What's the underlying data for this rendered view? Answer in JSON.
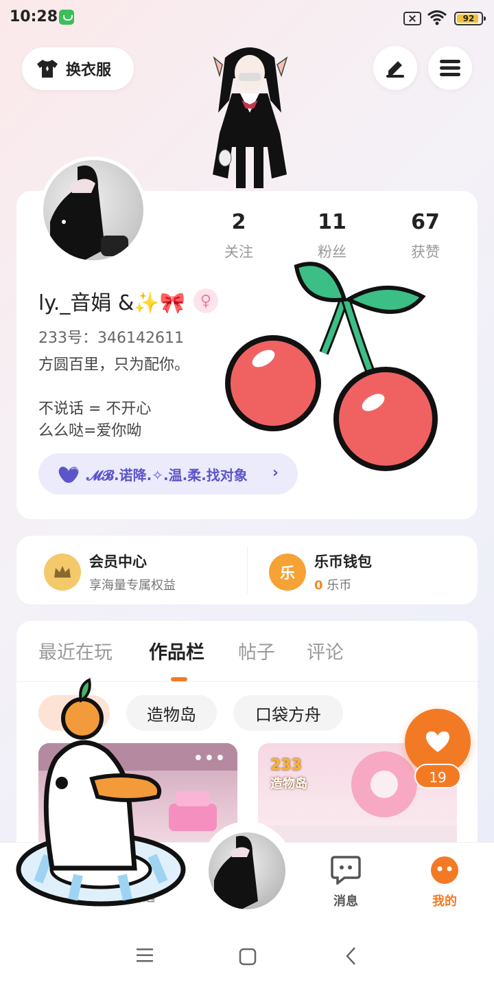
{
  "status_bar": {
    "time": "10:28",
    "battery": "92",
    "battery_level": 0.92,
    "icons": [
      "app-icon",
      "sim-off-icon",
      "wifi-icon",
      "battery-icon"
    ]
  },
  "header": {
    "dress_up_label": "换衣服",
    "edit_icon": "pen-icon",
    "menu_icon": "hamburger-icon"
  },
  "profile": {
    "stats": [
      {
        "value": "2",
        "label": "关注"
      },
      {
        "value": "11",
        "label": "粉丝"
      },
      {
        "value": "67",
        "label": "获赞"
      }
    ],
    "username": "ly._音娟 &✨🎀",
    "gender_symbol": "♀",
    "uid": "233号：346142611",
    "bio_lines": [
      "方圆百里，只为配你。",
      "",
      "不说话 = 不开心",
      "么么哒=爱你呦"
    ],
    "tag_text": "𝓜𝓑.诺降.✧.温.柔.找对象"
  },
  "member": {
    "title": "会员中心",
    "subtitle": "享海量专属权益"
  },
  "wallet": {
    "title": "乐币钱包",
    "amount": "0",
    "unit": "乐币",
    "icon_char": "乐"
  },
  "tabs": [
    {
      "label": "最近在玩",
      "active": false
    },
    {
      "label": "作品栏",
      "active": true
    },
    {
      "label": "帖子",
      "active": false
    },
    {
      "label": "评论",
      "active": false
    }
  ],
  "chips": [
    "造物岛",
    "口袋方舟"
  ],
  "works": [
    {
      "more": "•••"
    },
    {
      "logo_top": "233",
      "logo_bottom": "造物岛"
    }
  ],
  "like_count": "19",
  "bottom_nav": [
    {
      "label": "精选"
    },
    {
      "label": "消息"
    },
    {
      "label": "我的"
    }
  ],
  "colors": {
    "accent": "#f37a25",
    "tag_text": "#5b55c9",
    "tag_bg": "#ecebfb"
  }
}
